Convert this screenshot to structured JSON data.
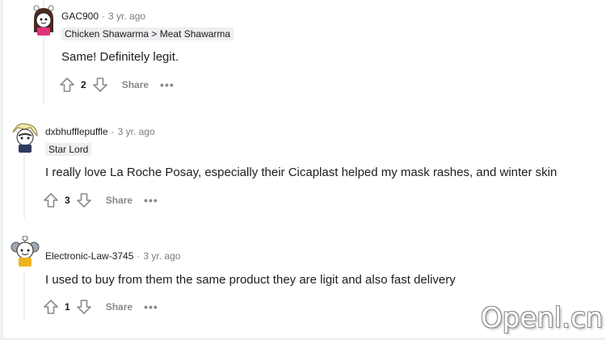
{
  "comments": [
    {
      "username": "GAC900",
      "time": "3 yr. ago",
      "flair": "Chicken Shawarma > Meat Shawarma",
      "body": "Same! Definitely legit.",
      "score": "2",
      "share_label": "Share",
      "more_label": "•••",
      "avatar_icon": "snoo-avatar-icon"
    },
    {
      "username": "dxbhufflepuffle",
      "time": "3 yr. ago",
      "flair": "Star Lord",
      "body": "I really love La Roche Posay, especially their Cicaplast helped my mask rashes, and winter skin",
      "score": "3",
      "share_label": "Share",
      "more_label": "•••",
      "avatar_icon": "snoo-avatar-icon"
    },
    {
      "username": "Electronic-Law-3745",
      "time": "3 yr. ago",
      "flair": "",
      "body": "I used to buy from them the same product they are ligit and also fast delivery",
      "score": "1",
      "share_label": "Share",
      "more_label": "•••",
      "avatar_icon": "snoo-avatar-icon"
    }
  ],
  "separator": "·",
  "watermark": "Openl.cn",
  "colors": {
    "thread_line": "#edeff1",
    "meta_gray": "#7c7c7c",
    "flair_bg": "#edeff1",
    "action_gray": "#878a8c"
  }
}
